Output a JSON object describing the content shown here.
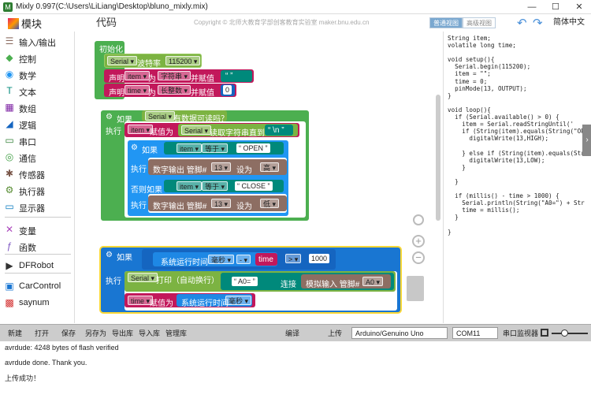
{
  "window": {
    "title": "Mixly 0.997(C:\\Users\\LiLiang\\Desktop\\bluno_mixly.mix)",
    "minimize": "—",
    "maximize": "☐",
    "close": "✕"
  },
  "header": {
    "logo": "模块",
    "code_tab": "代码",
    "copyright": "Copyright © 北师大教育学部创客教育实验室 maker.bnu.edu.cn",
    "view_normal": "普通视图",
    "view_advanced": "高级视图",
    "language": "简体中文 ▾"
  },
  "sidebar": {
    "items": [
      {
        "label": "输入/输出",
        "icon": "io-icon",
        "color": "#8d6e63"
      },
      {
        "label": "控制",
        "icon": "gamepad-icon",
        "color": "#4caf50"
      },
      {
        "label": "数学",
        "icon": "math-icon",
        "color": "#2196f3"
      },
      {
        "label": "文本",
        "icon": "text-icon",
        "color": "#00897b"
      },
      {
        "label": "数组",
        "icon": "array-icon",
        "color": "#7b1fa2"
      },
      {
        "label": "逻辑",
        "icon": "logic-icon",
        "color": "#1565c0"
      },
      {
        "label": "串口",
        "icon": "serial-icon",
        "color": "#2e7d32"
      },
      {
        "label": "通信",
        "icon": "comm-icon",
        "color": "#43a047"
      },
      {
        "label": "传感器",
        "icon": "sensor-icon",
        "color": "#795548"
      },
      {
        "label": "执行器",
        "icon": "actuator-icon",
        "color": "#558b2f"
      },
      {
        "label": "显示器",
        "icon": "display-icon",
        "color": "#0277bd"
      },
      {
        "label": "变量",
        "icon": "variable-icon",
        "color": "#ab47bc"
      },
      {
        "label": "函数",
        "icon": "function-icon",
        "color": "#7e57c2"
      },
      {
        "label": "DFRobot",
        "icon": "play-icon",
        "color": "#333333"
      },
      {
        "label": "CarControl",
        "icon": "car-icon",
        "color": "#1976d2"
      },
      {
        "label": "saynum",
        "icon": "cube-icon",
        "color": "#d32f2f"
      }
    ]
  },
  "blocks": {
    "setup_label": "初始化",
    "serial": "Serial ▾",
    "baud_label": "波特率",
    "baud_value": "115200 ▾",
    "declare": "声明",
    "item_var": "item ▾",
    "as": "为",
    "type_string": "字符串 ▾",
    "and_assign": "并赋值",
    "empty_string": "“ ”",
    "time_var": "time ▾",
    "type_long": "长整数 ▾",
    "zero": "0",
    "if1": "如果",
    "has_data": "有数据可读吗？",
    "exec": "执行",
    "assign": "赋值为",
    "read_until": "读取字符串直到",
    "newline_char": "“ \\n ”",
    "if_label": "如果",
    "equals": "等于 ▾",
    "open_str": "“ OPEN ”",
    "digital_write": "数字输出 管脚#",
    "pin13": "13 ▾",
    "set_to": "设为",
    "high": "高 ▾",
    "else_if": "否则如果",
    "close_str": "“ CLOSE ”",
    "low": "低 ▾",
    "runtime": "系统运行时间",
    "ms": "毫秒 ▾",
    "minus": "- ▾",
    "time_ref": "time",
    "gt": "> ▾",
    "thousand": "1000",
    "print_label": "打印（自动换行）",
    "a0_str": "“ A0= ”",
    "concat": "连接",
    "analog_read": "模拟输入 管脚#",
    "a0_pin": "A0 ▾",
    "time_assign_var": "time ▾",
    "time_assign": "赋值为"
  },
  "code": "String item;\nvolatile long time;\n\nvoid setup(){\n  Serial.begin(115200);\n  item = \"\";\n  time = 0;\n  pinMode(13, OUTPUT);\n}\n\nvoid loop(){\n  if (Serial.available() > 0) {\n    item = Serial.readStringUntil('\n    if (String(item).equals(String(\"OPE\n      digitalWrite(13,HIGH);\n\n    } else if (String(item).equals(Str\n      digitalWrite(13,LOW);\n    }\n\n  }\n\n  if (millis() - time > 1000) {\n    Serial.println(String(\"A0=\") + Str\n    time = millis();\n  }\n\n}",
  "toolbar": {
    "new": "新建",
    "open": "打开",
    "save": "保存",
    "save_as": "另存为",
    "export_lib": "导出库",
    "import_lib": "导入库",
    "manage_lib": "管理库",
    "compile": "编译",
    "upload": "上传",
    "board": "Arduino/Genuino Uno",
    "port": "COM11",
    "monitor": "串口监视器"
  },
  "console": {
    "lines": [
      "avrdude: 4248 bytes of flash verified",
      "avrdude done.  Thank you.",
      "上传成功！"
    ]
  }
}
